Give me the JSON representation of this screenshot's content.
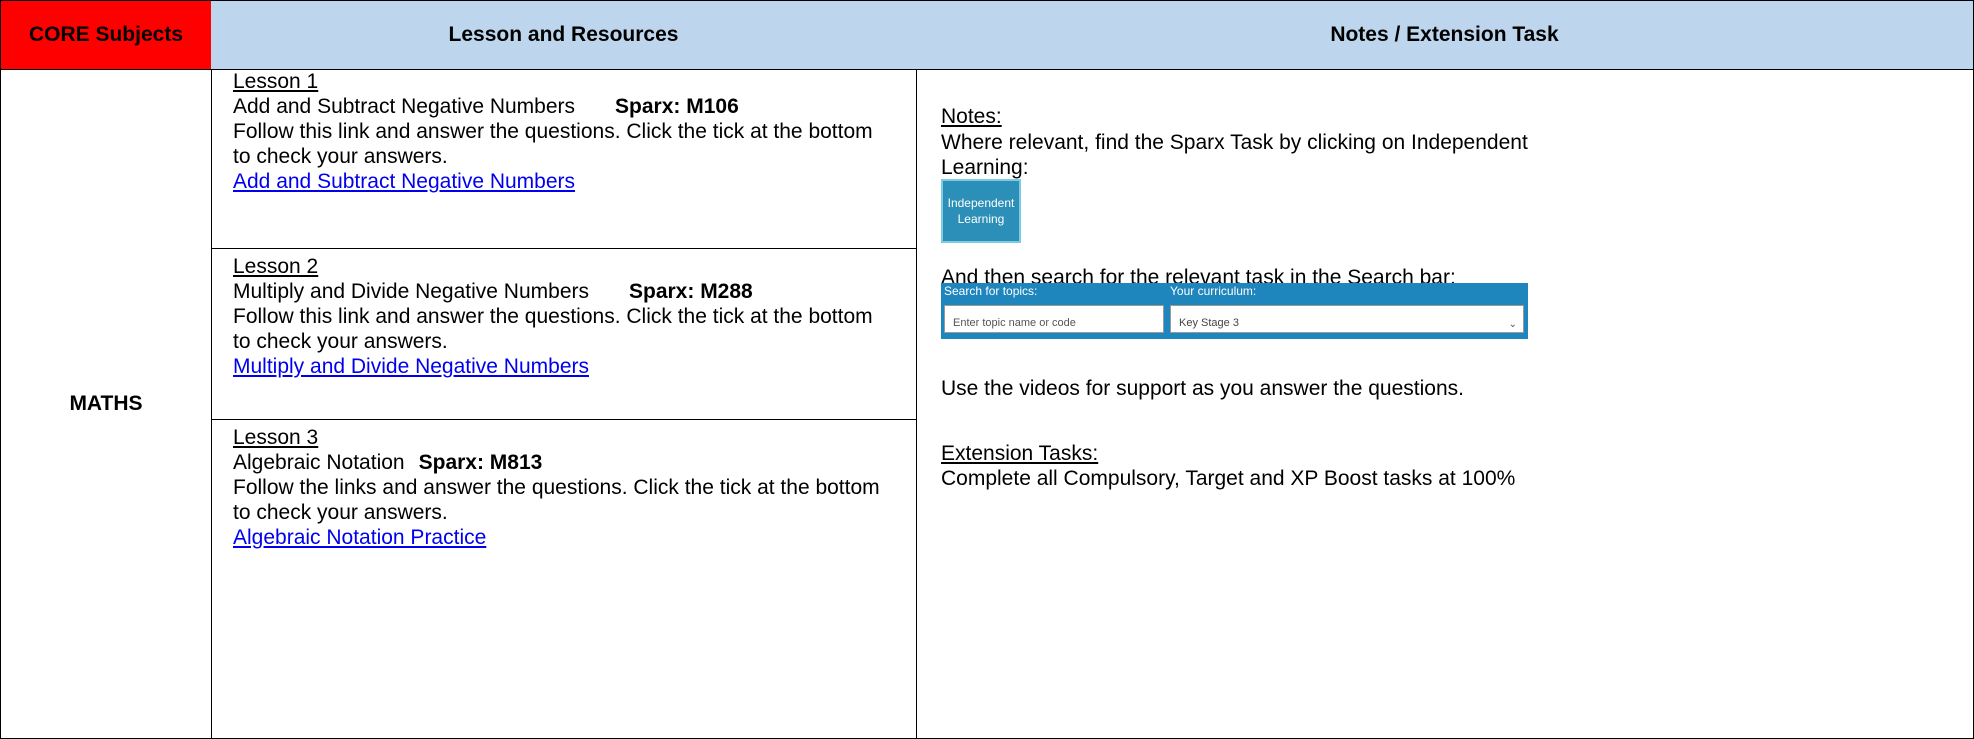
{
  "headers": {
    "core": "CORE Subjects",
    "lesson": "Lesson and Resources",
    "notes": "Notes / Extension Task"
  },
  "subject": "MATHS",
  "lessons": [
    {
      "title": "Lesson 1",
      "name": "Add and Subtract Negative Numbers",
      "code": "Sparx: M106",
      "instruction_line1": "Follow this link and answer the questions. Click the tick at the bottom",
      "instruction_line2": "to check your answers.",
      "link": "Add and Subtract Negative Numbers"
    },
    {
      "title": "Lesson 2",
      "name": "Multiply and Divide Negative Numbers",
      "code": "Sparx: M288",
      "instruction_line1": "Follow this link and answer the questions. Click the tick at the bottom",
      "instruction_line2": "to check your answers.",
      "link": "Multiply and Divide Negative Numbers"
    },
    {
      "title": "Lesson 3",
      "name": "Algebraic Notation",
      "code": "Sparx: M813",
      "instruction_line1": "Follow the links and answer the questions. Click the tick at the bottom",
      "instruction_line2": "to check your answers.",
      "link": "Algebraic Notation Practice"
    }
  ],
  "notes": {
    "heading": "Notes:",
    "line1": "Where relevant, find the Sparx Task by clicking on Independent",
    "line2": "Learning:",
    "button_line1": "Independent",
    "button_line2": "Learning",
    "search_instruction": "And then search for the relevant task in the Search bar:",
    "search_topics_label": "Search for topics:",
    "search_placeholder": "Enter topic name or code",
    "curriculum_label": "Your curriculum:",
    "curriculum_value": "Key Stage 3",
    "videos": "Use the videos for support as you answer the questions.",
    "extension_heading": "Extension Tasks:",
    "extension_text": "Complete all Compulsory, Target and XP Boost tasks at 100%"
  }
}
